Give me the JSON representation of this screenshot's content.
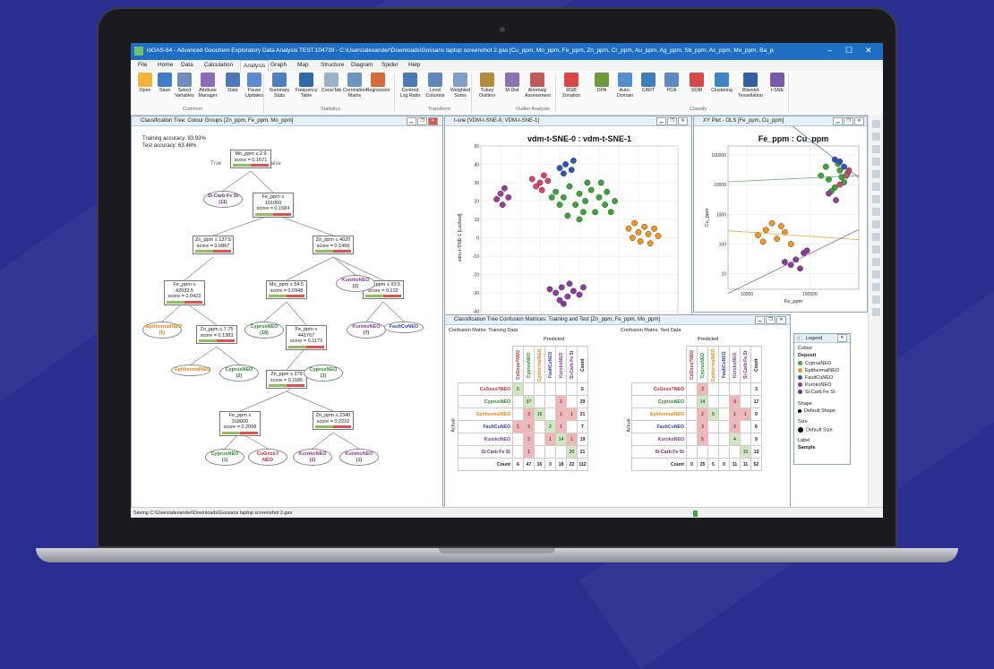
{
  "window": {
    "title": "ioGAS-64 - Advanced Geochem Exploratory Data Analysis TEST.104739 - C:\\Users\\alexander\\Downloads\\Gossans laptop screenshot 2.gas  [Cu_ppm, Mo_ppm, Fe_ppm, Zn_ppm, Cr_ppm, Au_ppm, Ag_ppm, Sb_ppm, As_ppm, Mo_ppm, Ba_ppm, Sn_ppm, Bi_ppm]"
  },
  "menu": [
    "File",
    "Home",
    "Data",
    "Calculation",
    "Analysis",
    "Graph",
    "Map",
    "Structure",
    "Diagram",
    "Spider",
    "Help"
  ],
  "menu_active": "Analysis",
  "ribbon": {
    "buttons": [
      {
        "label": "Open",
        "color": "#f2b53c"
      },
      {
        "label": "Save",
        "color": "#3f7fc9"
      },
      {
        "label": "Select Variables",
        "color": "#6a8fb8"
      },
      {
        "label": "Attribute Manager",
        "color": "#8b6bb7"
      },
      {
        "label": "Data",
        "color": "#4f78b6"
      },
      {
        "label": "Pause Updates",
        "color": "#5b8ad1"
      },
      {
        "label": "Summary Stats",
        "color": "#4d7fbf"
      },
      {
        "label": "Frequency Table",
        "color": "#2f6aa8"
      },
      {
        "label": "CrossTab",
        "color": "#9bb1c8"
      },
      {
        "label": "Correlation Matrix",
        "color": "#6c93c4"
      },
      {
        "label": "Regression",
        "color": "#d46b3a"
      },
      {
        "label": "Centred Log Ratio",
        "color": "#4a7ab4"
      },
      {
        "label": "Level Columns",
        "color": "#5f87b7"
      },
      {
        "label": "Weighted Sums",
        "color": "#7f9fc6"
      },
      {
        "label": "Tukey Outliers",
        "color": "#b58b3b"
      },
      {
        "label": "M-Dist",
        "color": "#8d73b5"
      },
      {
        "label": "Anomaly Assessment",
        "color": "#c05a5a"
      },
      {
        "label": "RGB Zonation",
        "color": "#d44"
      },
      {
        "label": "DPA",
        "color": "#6f9a3e"
      },
      {
        "label": "Auto-Domain",
        "color": "#4e8fcc"
      },
      {
        "label": "CART",
        "color": "#3e7fb9"
      },
      {
        "label": "PCA",
        "color": "#5c8ac1"
      },
      {
        "label": "SOM",
        "color": "#d7484a"
      },
      {
        "label": "Clustering",
        "color": "#3a86c8"
      },
      {
        "label": "Wavelet Tessellation",
        "color": "#2f5f9e"
      },
      {
        "label": "t-SNE",
        "color": "#7a5aa8"
      }
    ],
    "groups": [
      "Common",
      "Statistics",
      "Transform",
      "Outlier Analysis",
      "Classify"
    ]
  },
  "tree_panel": {
    "title": "Classification Tree: Colour Groups [Zn_ppm, Fe_ppm, Mo_ppm]",
    "training_accuracy": "Training accuracy: 83.93%",
    "test_accuracy": "Test accuracy: 63.46%",
    "true_label": "True",
    "false_label": "False",
    "nodes": [
      {
        "rule": "Mo_ppm ≤ 2.9",
        "score": "score = 0.1671"
      },
      {
        "rule": "Fe_ppm ≤ 101060",
        "score": "score = 0.1584"
      },
      {
        "rule": "Zn_ppm ≤ 127.5",
        "score": "score = 0.0867"
      },
      {
        "rule": "Zn_ppm ≤ 4020",
        "score": "score = 0.1456"
      },
      {
        "rule": "Fe_ppm ≤ 42032.5",
        "score": "score = 0.0423"
      },
      {
        "rule": "Mo_ppm ≤ 54.5",
        "score": "score = 0.0948"
      },
      {
        "rule": "Mo_ppm ≤ 93.5",
        "score": "score = 0.132"
      },
      {
        "rule": "Zn_ppm ≤ 7.75",
        "score": "score = 0.1383"
      },
      {
        "rule": "Fe_ppm ≤ 441767",
        "score": "score = 0.1173"
      },
      {
        "rule": "Zn_ppm ≤ 279",
        "score": "score = 0.1185"
      },
      {
        "rule": "Fe_ppm ≤ 318000",
        "score": "score = 0.2098"
      },
      {
        "rule": "Zn_ppm ≤ 2340",
        "score": "score = 0.2222"
      }
    ],
    "leaves": [
      {
        "name": "Si-Carb Fe St",
        "count": "(11)",
        "color": "#7a2a8a"
      },
      {
        "name": "KurokoNEO",
        "count": "(2)",
        "color": "#8a3a9a"
      },
      {
        "name": "EpithermalNEO",
        "count": "(5)",
        "color": "#e08a1c"
      },
      {
        "name": "CyprusNEO",
        "count": "(18)",
        "color": "#2a8a2a"
      },
      {
        "name": "KurokoNEO",
        "count": "(7)",
        "color": "#8a3a9a"
      },
      {
        "name": "FaultCuNEO",
        "count": "",
        "color": "#2a4ab0"
      },
      {
        "name": "EpithermalNEO",
        "count": "",
        "color": "#e08a1c"
      },
      {
        "name": "CyprusNEO",
        "count": "(2)",
        "color": "#2a8a2a"
      },
      {
        "name": "CyprusNEO",
        "count": "(3)",
        "color": "#2a8a2a"
      },
      {
        "name": "CyprusNEO",
        "count": "(1)",
        "color": "#2a8a2a"
      },
      {
        "name": "CuGoss?NEO",
        "count": "",
        "color": "#c02a2a"
      },
      {
        "name": "KurokoNEO",
        "count": "(2)",
        "color": "#8a3a9a"
      },
      {
        "name": "KurokoNEO",
        "count": "(1)",
        "color": "#8a3a9a"
      }
    ]
  },
  "tsne_panel": {
    "header": "t-sne [VDM-t-SNE-0, VDM-t-SNE-1]"
  },
  "xy_panel": {
    "header": "XY Plot - OLS [Fe_ppm, Cu_ppm]"
  },
  "chart_data": [
    {
      "type": "scatter",
      "title": "vdm-t-SNE-0 : vdm-t-SNE-1",
      "xlabel": "vdm-t-SNE-0 [Locked]",
      "ylabel": "vdm-t-SNE-1 [Locked]",
      "xlim": [
        -50,
        50
      ],
      "ylim": [
        -50,
        50
      ],
      "xticks": [
        "-50",
        "-40",
        "-30",
        "-20",
        "-10",
        "0",
        "10",
        "20",
        "30",
        "40",
        "50"
      ],
      "yticks": [
        "-50",
        "-40",
        "-30",
        "-20",
        "-10",
        "0",
        "10",
        "20",
        "30",
        "40",
        "50"
      ],
      "grid": true,
      "series": [
        {
          "name": "CyprusNEO",
          "color": "#3aa63a",
          "points": [
            [
              -12,
              25
            ],
            [
              -8,
              22
            ],
            [
              -5,
              28
            ],
            [
              0,
              24
            ],
            [
              3,
              20
            ],
            [
              6,
              26
            ],
            [
              10,
              22
            ],
            [
              13,
              18
            ],
            [
              -2,
              18
            ],
            [
              -10,
              18
            ],
            [
              2,
              14
            ],
            [
              8,
              14
            ],
            [
              14,
              25
            ],
            [
              18,
              20
            ],
            [
              -6,
              12
            ],
            [
              4,
              30
            ],
            [
              -14,
              22
            ],
            [
              11,
              30
            ],
            [
              16,
              14
            ],
            [
              0,
              10
            ]
          ]
        },
        {
          "name": "EpithermalNEO",
          "color": "#f0961c",
          "points": [
            [
              25,
              5
            ],
            [
              28,
              8
            ],
            [
              30,
              3
            ],
            [
              33,
              6
            ],
            [
              35,
              2
            ],
            [
              38,
              5
            ],
            [
              31,
              -2
            ],
            [
              27,
              0
            ],
            [
              36,
              -3
            ],
            [
              40,
              1
            ]
          ]
        },
        {
          "name": "FaultCuNEO",
          "color": "#2f55b8",
          "points": [
            [
              -10,
              38
            ],
            [
              -7,
              40
            ],
            [
              -4,
              37
            ],
            [
              -8,
              35
            ],
            [
              -3,
              42
            ]
          ]
        },
        {
          "name": "KurokoNEO",
          "color": "#8a3aa0",
          "points": [
            [
              -15,
              -28
            ],
            [
              -12,
              -30
            ],
            [
              -9,
              -27
            ],
            [
              -6,
              -32
            ],
            [
              -3,
              -29
            ],
            [
              0,
              -31
            ],
            [
              -10,
              -34
            ],
            [
              -5,
              -25
            ],
            [
              2,
              -27
            ],
            [
              -8,
              -36
            ]
          ]
        },
        {
          "name": "Si-Carb Fe St",
          "color": "#9a3a9a",
          "points": [
            [
              -40,
              24
            ],
            [
              -38,
              27
            ],
            [
              -42,
              21
            ],
            [
              -36,
              22
            ],
            [
              -39,
              18
            ]
          ]
        },
        {
          "name": "CuGoss?NEO",
          "color": "#d9466a",
          "points": [
            [
              -20,
              30
            ],
            [
              -18,
              34
            ],
            [
              -22,
              28
            ],
            [
              -16,
              31
            ],
            [
              -24,
              32
            ],
            [
              -19,
              26
            ]
          ]
        }
      ]
    },
    {
      "type": "scatter",
      "title": "Fe_ppm : Cu_ppm",
      "xlabel": "Fe_ppm",
      "ylabel": "Cu_ppm",
      "log_x": true,
      "log_y": true,
      "xticks": [
        "10000",
        "100000"
      ],
      "yticks": [
        "10",
        "100",
        "1000",
        "10000",
        "100000"
      ],
      "xlim": [
        5000,
        600000
      ],
      "ylim": [
        3,
        200000
      ],
      "grid": true,
      "series": [
        {
          "name": "CyprusNEO",
          "color": "#3aa63a",
          "points": [
            [
              150000,
              20000
            ],
            [
              200000,
              15000
            ],
            [
              300000,
              30000
            ],
            [
              250000,
              8000
            ],
            [
              400000,
              25000
            ],
            [
              350000,
              12000
            ],
            [
              180000,
              40000
            ],
            [
              280000,
              50000
            ],
            [
              320000,
              18000
            ],
            [
              220000,
              6000
            ]
          ]
        },
        {
          "name": "EpithermalNEO",
          "color": "#f0961c",
          "points": [
            [
              15000,
              200
            ],
            [
              20000,
              300
            ],
            [
              30000,
              150
            ],
            [
              25000,
              500
            ],
            [
              40000,
              250
            ],
            [
              18000,
              120
            ],
            [
              35000,
              400
            ],
            [
              50000,
              100
            ]
          ]
        },
        {
          "name": "FaultCuNEO",
          "color": "#2f55b8",
          "points": [
            [
              300000,
              60000
            ],
            [
              350000,
              40000
            ],
            [
              250000,
              70000
            ]
          ]
        },
        {
          "name": "KurokoNEO",
          "color": "#8a3aa0",
          "points": [
            [
              60000,
              30
            ],
            [
              80000,
              50
            ],
            [
              50000,
              20
            ],
            [
              70000,
              15
            ],
            [
              90000,
              60
            ],
            [
              40000,
              25
            ]
          ]
        },
        {
          "name": "Si-Carb Fe St",
          "color": "#9a3a9a",
          "points": [
            [
              200000,
              5000
            ],
            [
              260000,
              3000
            ]
          ]
        },
        {
          "name": "CuGoss?NEO",
          "color": "#d9466a",
          "points": [
            [
              380000,
              20000
            ],
            [
              420000,
              30000
            ],
            [
              300000,
              10000
            ]
          ]
        }
      ]
    }
  ],
  "confusion_panel": {
    "title": "Classification Tree Confusion Matrices: Training and Test [Zn_ppm, Fe_ppm, Mo_ppm]",
    "training_label": "Confusion Matrix: Training Data",
    "test_label": "Confusion Matrix: Test Data",
    "predicted_label": "Predicted",
    "actual_label": "Actual",
    "columns": [
      "CuGoss?NEO",
      "CyprusNEO",
      "EpithermalNEO",
      "FaultCuNEO",
      "KurokoNEO",
      "Si-Carb Fe St",
      "Count"
    ],
    "rows": [
      "CuGoss?NEO",
      "CyprusNEO",
      "EpithermalNEO",
      "FaultCuNEO",
      "KurokoNEO",
      "Si-Carb Fe St",
      "Count"
    ],
    "training": [
      [
        "5",
        "",
        "",
        "",
        "",
        "",
        "5"
      ],
      [
        "",
        "37",
        "",
        "",
        "2",
        "",
        "29"
      ],
      [
        "",
        "3",
        "16",
        "",
        "1",
        "1",
        "21"
      ],
      [
        "1",
        "3",
        "",
        "2",
        "1",
        "",
        "7"
      ],
      [
        "",
        "3",
        "",
        "1",
        "14",
        "1",
        "19"
      ],
      [
        "",
        "1",
        "",
        "",
        "",
        "20",
        "21"
      ],
      [
        "6",
        "47",
        "16",
        "3",
        "18",
        "22",
        "112"
      ]
    ],
    "test": [
      [
        "",
        "3",
        "",
        "",
        "",
        "",
        "3"
      ],
      [
        "",
        "14",
        "",
        "",
        "3",
        "",
        "17"
      ],
      [
        "",
        "2",
        "5",
        "",
        "1",
        "1",
        "9"
      ],
      [
        "",
        "3",
        "",
        "",
        "3",
        "",
        "6"
      ],
      [
        "",
        "5",
        "",
        "",
        "4",
        "",
        "9"
      ],
      [
        "",
        "",
        "",
        "",
        "",
        "10",
        "10"
      ],
      [
        "0",
        "25",
        "5",
        "0",
        "11",
        "11",
        "52"
      ]
    ]
  },
  "legend": {
    "title": "Legend",
    "colour_label": "Colour",
    "deposit_label": "Deposit",
    "items": [
      {
        "name": "CyprusNEO",
        "color": "#3aa63a"
      },
      {
        "name": "EpithermalNEO",
        "color": "#f0961c"
      },
      {
        "name": "FaultCuNEO",
        "color": "#2f55b8"
      },
      {
        "name": "KurokoNEO",
        "color": "#8a3aa0"
      },
      {
        "name": "Si-Carb Fe St",
        "color": "#7a2a8a"
      }
    ],
    "shape_label": "Shape",
    "shape_value": "Default Shape",
    "size_label": "Size",
    "size_value": "Default Size",
    "label_label": "Label",
    "label_value": "Sample"
  },
  "status": "Saving C:\\Users\\alexander\\Downloads\\Gossans laptop screenshot 2.gas"
}
